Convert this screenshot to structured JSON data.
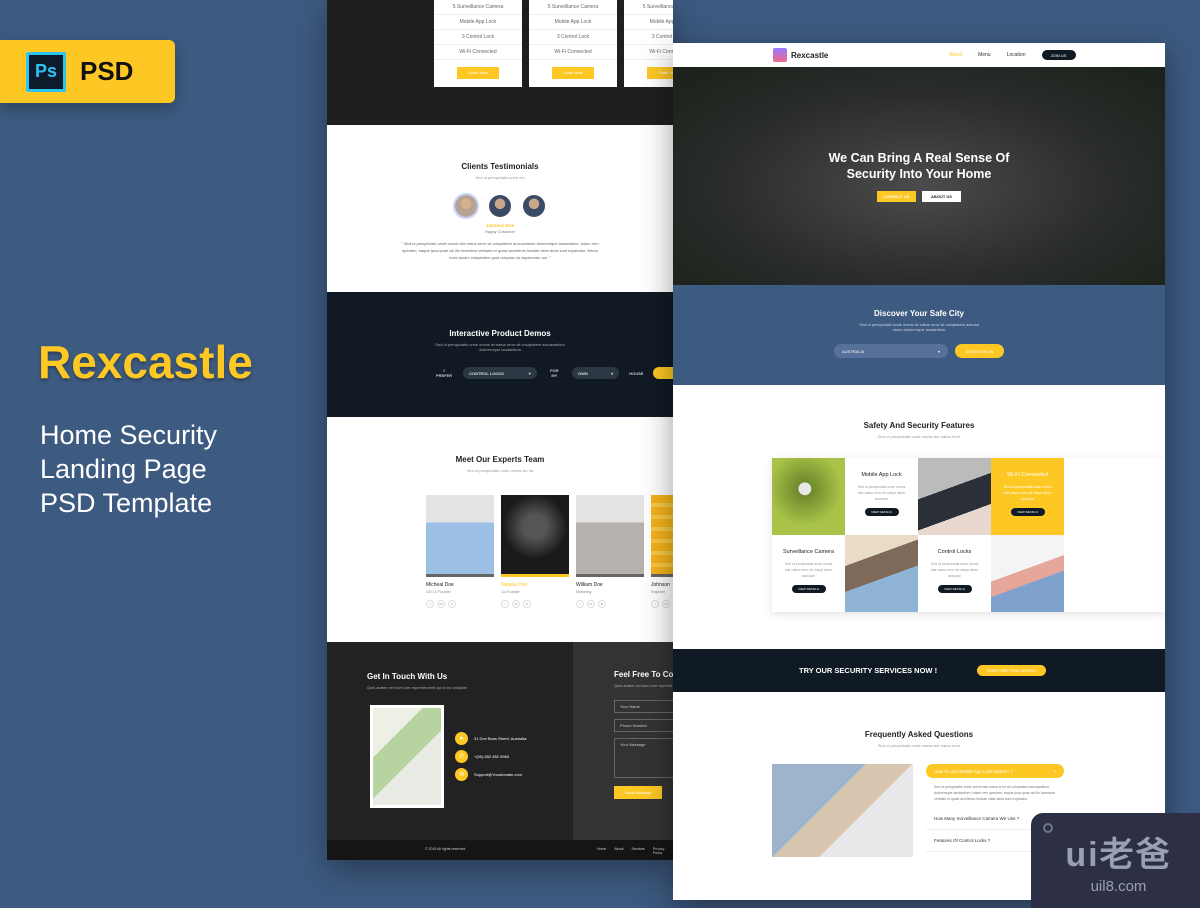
{
  "badge": {
    "icon_text": "Ps",
    "label": "PSD"
  },
  "brand": {
    "title": "Rexcastle",
    "subtitle_lines": [
      "Home Security",
      "Landing Page",
      "PSD Template"
    ]
  },
  "back_page": {
    "pricing": {
      "items": [
        "5 Surveillance Camera",
        "Mobile App Lock",
        "3 Control Lock",
        "Wi-Fi Connected"
      ],
      "button": "Order Now"
    },
    "testimonials": {
      "title": "Clients Testimonials",
      "subtitle": "Sed ut perspiciatis unde om",
      "name": "Johnson Doe",
      "role": "Happy Customer",
      "quote": "\" Sed ut perspiciatis unde omnis iste natus error sit voluptatem accusantium doloremque laudantium, totam rem aperiam, eaque ipsa quae ab illo inventore veritatis et quasi architecto beatae vitae dicta sunt explicabo. Nemo enim ipsam voluptatem quia voluptas sit aspernatur aut. \""
    },
    "demos": {
      "title": "Interactive Product Demos",
      "subtitle": "Sed ut perspiciatis unde omnis ist natus error sit voluptatem accusantium doloremque laudantium",
      "label1": "I PREFER",
      "select1": "CONTROL LOCKS",
      "label2": "FOR MY",
      "select2": "OWN",
      "label3": "HOUSE"
    },
    "team": {
      "title": "Meet Our Experts Team",
      "subtitle": "Sed ut perspiciatis unde omnis ste na",
      "members": [
        {
          "name": "Micheal Doe",
          "role": "CEO & Founder"
        },
        {
          "name": "Natalia Doe",
          "role": "Co-Founder"
        },
        {
          "name": "William Doe",
          "role": "Marketing"
        },
        {
          "name": "Johnson",
          "role": "Engineer"
        }
      ],
      "social": [
        "f",
        "tw",
        "in"
      ]
    },
    "contact": {
      "title": "Get In Touch With Us",
      "subtitle": "Quis autem vel eum iure reprehenderit qui in ea voluptat",
      "address": "31 Don Boss Street, Australia.",
      "phone": "+(00) 852 852 9963",
      "email": "Support@Yourdomain.com",
      "form_title": "Feel Free To Contact",
      "form_sub": "Quis autem vel eum iure reprehe",
      "name_ph": "Your Name",
      "phone_ph": "Phone Number",
      "msg_ph": "Your Message",
      "send": "Send Message"
    },
    "footer": {
      "copyright": "© 2019 All rights reserved.",
      "links": [
        "Home",
        "About",
        "Services",
        "Privacy Policy"
      ]
    }
  },
  "front_page": {
    "nav": {
      "logo": "Rexcastle",
      "links": [
        "About",
        "Menu",
        "Location"
      ],
      "active": "About",
      "join": "JOIN US"
    },
    "hero": {
      "title_line1": "We Can Bring A Real Sense Of",
      "title_line2": "Security Into Your Home",
      "btn_contact": "CONTACT US",
      "btn_about": "ABOUT US"
    },
    "city": {
      "title": "Discover Your Safe City",
      "subtitle": "Sed ut perspiciatis unde omnis ist natus error sit voluptatem accusa ntium doloremque laudantium",
      "select": "AUSTRALIA",
      "button": "SEARCH NOW"
    },
    "features": {
      "title": "Safety And Security Features",
      "subtitle": "Sed ut perspiciatis unde omnis iste natus error",
      "desc": "Sed ut perspiciatis unde omnis iste natus error sit volupt atem accusan",
      "button": "VIEW DETAILS",
      "cards": [
        "Mobile App Lock",
        "Wi-Fi Connected",
        "Surveillance Camera",
        "Control Locks"
      ]
    },
    "cta": {
      "text": "TRY OUR SECURITY SERVICES NOW !",
      "button": "START FREE TRIAL SERVICE"
    },
    "faq": {
      "title": "Frequently Asked Questions",
      "subtitle": "Sed ut perspiciatis unde omnis iste natus error",
      "active_q": "How To Use Mobile App Lock System ?",
      "answer": "Sed ut perspiciatis unde omnis iste natus error sit voluptatem accusantium doloremque laudantium, totam rem aperiam, eaque ipsa quae ab illo inventore veritatis et quasi architecto beatae vitae dicta sunt explicabo.",
      "questions": [
        "How Many Surveillance Camera We Use ?",
        "Features Of Control Locks ?"
      ]
    }
  },
  "watermark": {
    "big": "ui老爸",
    "url": "uil8.com"
  }
}
